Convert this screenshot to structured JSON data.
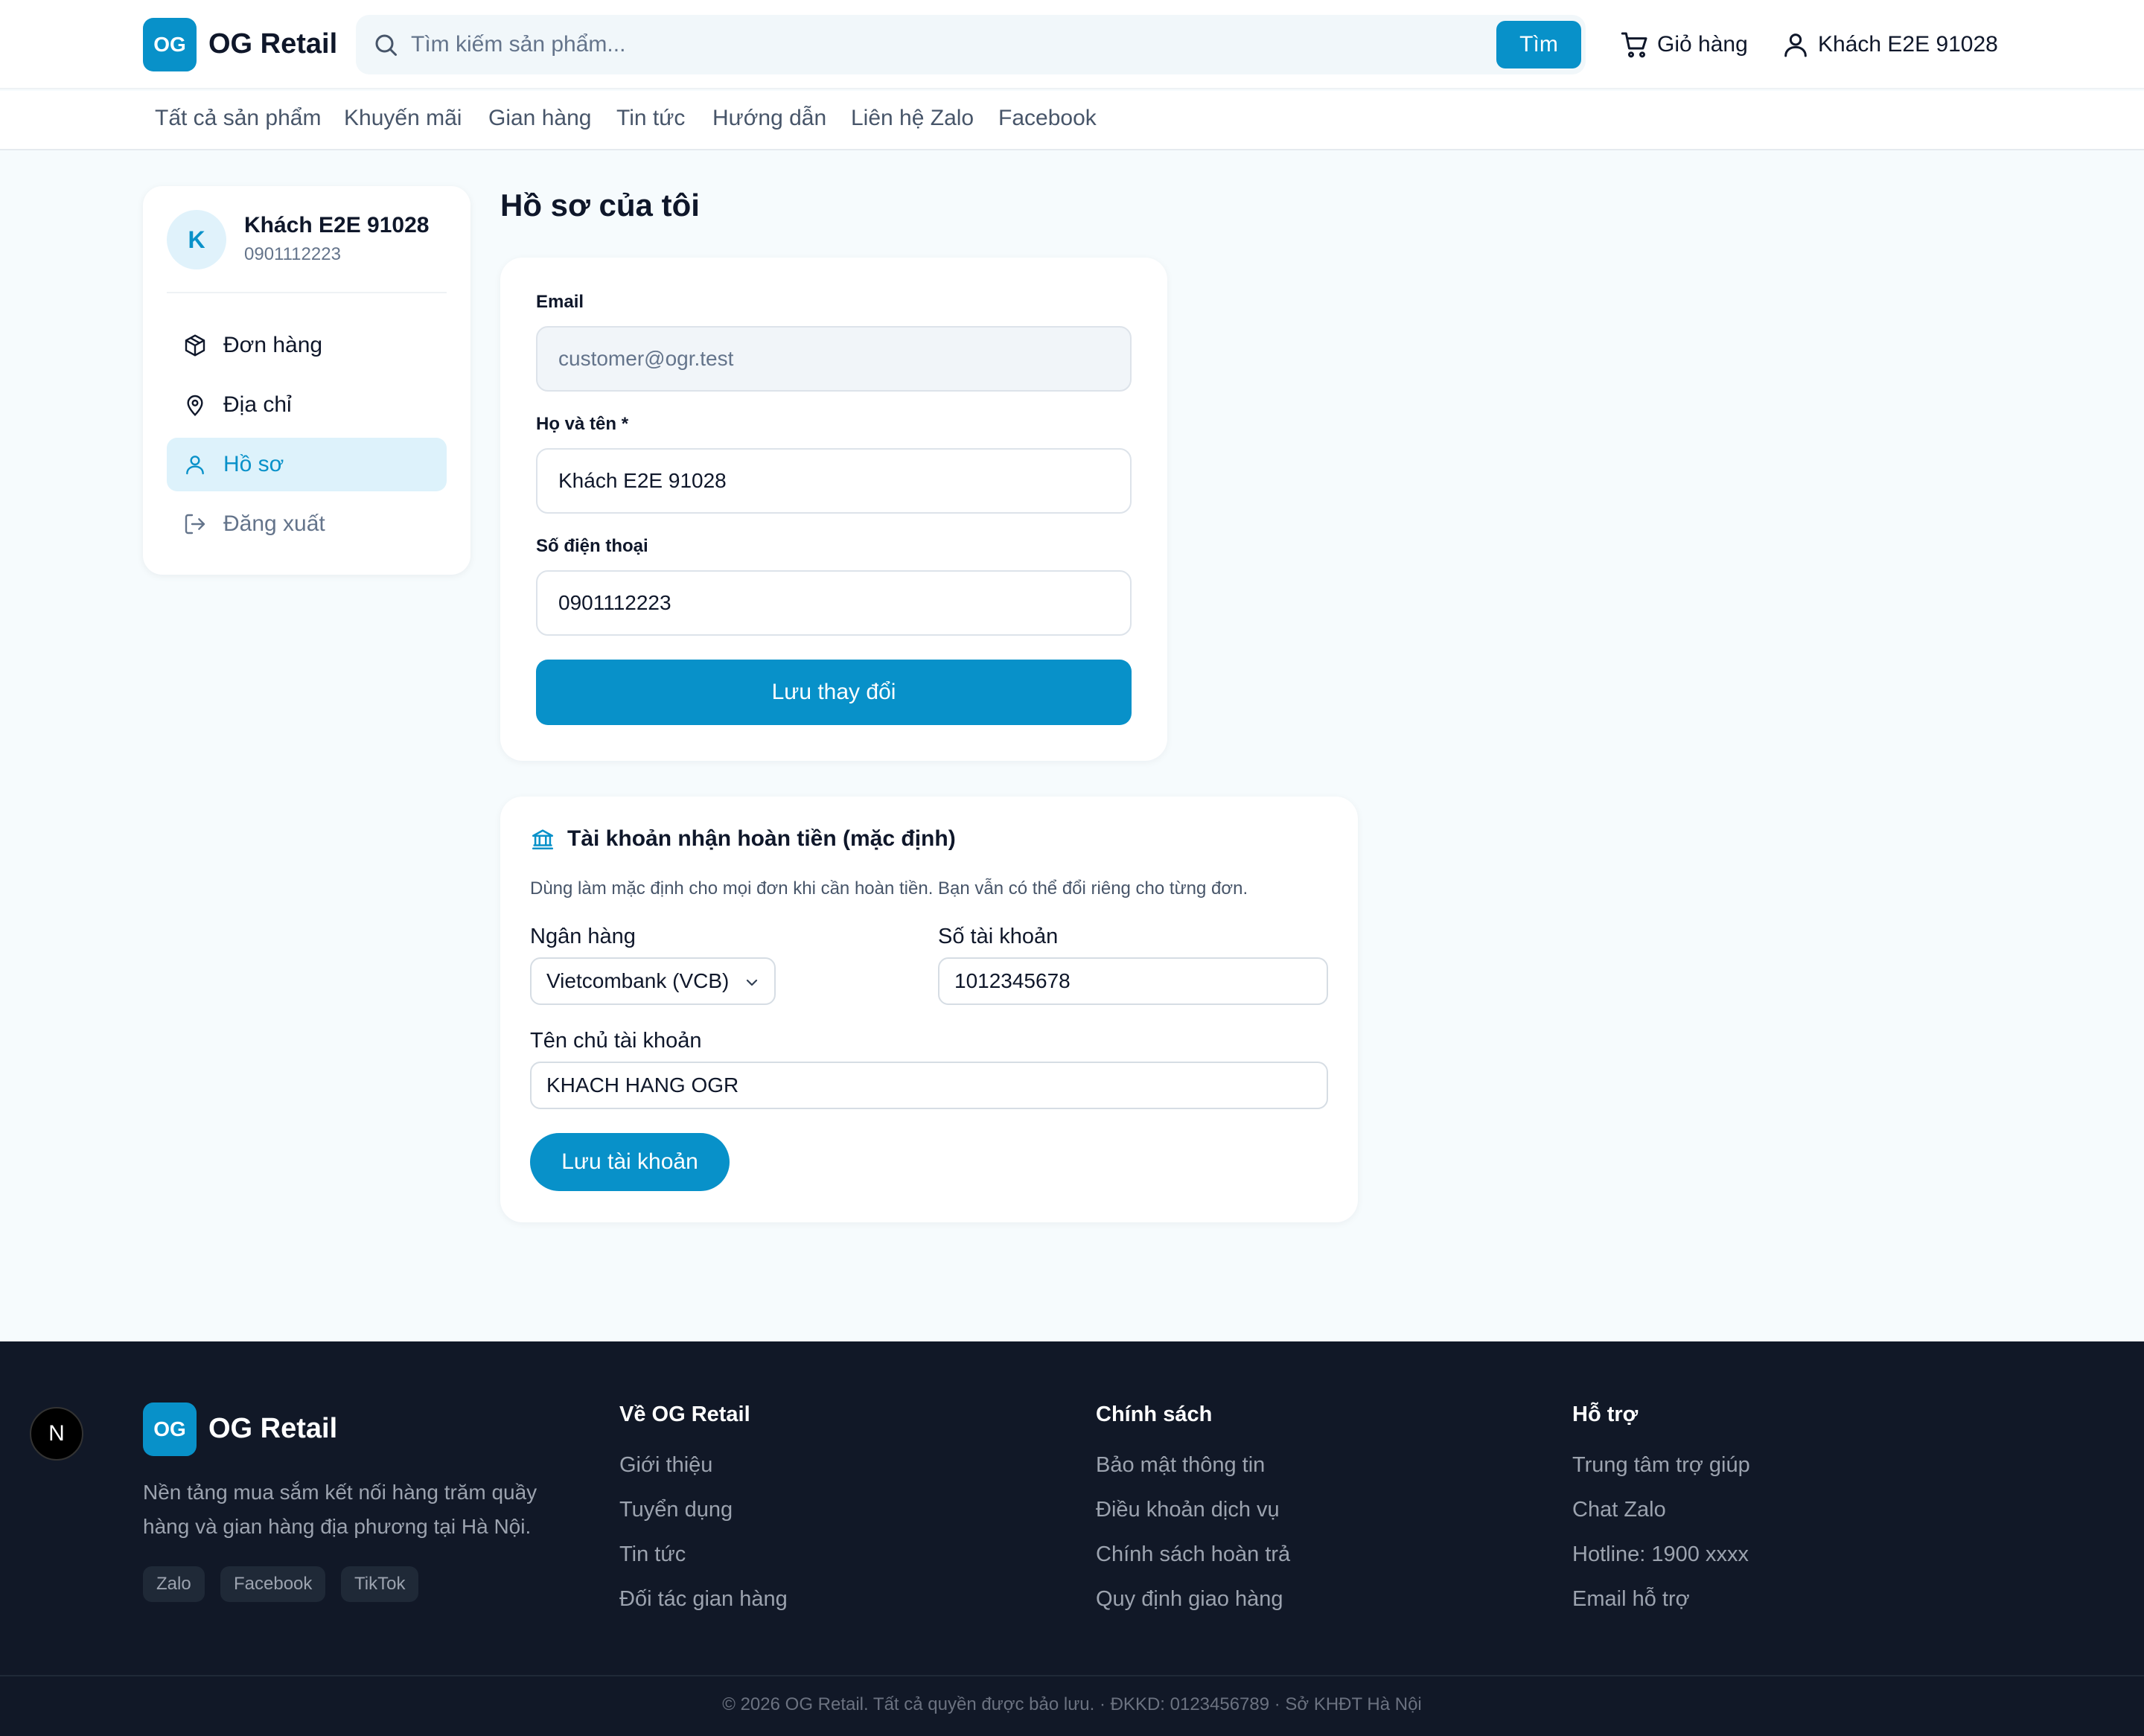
{
  "header": {
    "logo_badge": "OG",
    "logo_text": "OG Retail",
    "search_placeholder": "Tìm kiếm sản phẩm...",
    "search_button": "Tìm",
    "cart_label": "Giỏ hàng",
    "user_label": "Khách E2E 91028",
    "brand_color": "#0891c9"
  },
  "nav": {
    "items": [
      "Tất cả sản phẩm",
      "Khuyến mãi",
      "Gian hàng",
      "Tin tức",
      "Hướng dẫn",
      "Liên hệ Zalo",
      "Facebook"
    ]
  },
  "sidebar": {
    "avatar_letter": "K",
    "name": "Khách E2E 91028",
    "phone": "0901112223",
    "items": [
      {
        "label": "Đơn hàng",
        "icon": "package-icon"
      },
      {
        "label": "Địa chỉ",
        "icon": "map-pin-icon"
      },
      {
        "label": "Hồ sơ",
        "icon": "user-icon",
        "active": true
      },
      {
        "label": "Đăng xuất",
        "icon": "logout-icon"
      }
    ]
  },
  "profile": {
    "title": "Hồ sơ của tôi",
    "email_label": "Email",
    "email_value": "customer@ogr.test",
    "name_label": "Họ và tên *",
    "name_value": "Khách E2E 91028",
    "phone_label": "Số điện thoại",
    "phone_value": "0901112223",
    "save_button": "Lưu thay đổi"
  },
  "refund": {
    "title": "Tài khoản nhận hoàn tiền (mặc định)",
    "icon": "bank-icon",
    "description": "Dùng làm mặc định cho mọi đơn khi cần hoàn tiền. Bạn vẫn có thể đổi riêng cho từng đơn.",
    "bank_label": "Ngân hàng",
    "bank_value": "Vietcombank (VCB)",
    "account_number_label": "Số tài khoản",
    "account_number_value": "1012345678",
    "holder_label": "Tên chủ tài khoản",
    "holder_value": "KHACH HANG OGR",
    "save_button": "Lưu tài khoản"
  },
  "footer": {
    "next_badge": "N",
    "logo_badge": "OG",
    "logo_text": "OG Retail",
    "description": "Nền tảng mua sắm kết nối hàng trăm quầy hàng và gian hàng địa phương tại Hà Nội.",
    "socials": [
      "Zalo",
      "Facebook",
      "TikTok"
    ],
    "columns": [
      {
        "title": "Về OG Retail",
        "links": [
          "Giới thiệu",
          "Tuyển dụng",
          "Tin tức",
          "Đối tác gian hàng"
        ]
      },
      {
        "title": "Chính sách",
        "links": [
          "Bảo mật thông tin",
          "Điều khoản dịch vụ",
          "Chính sách hoàn trả",
          "Quy định giao hàng"
        ]
      },
      {
        "title": "Hỗ trợ",
        "links": [
          "Trung tâm trợ giúp",
          "Chat Zalo",
          "Hotline: 1900 xxxx",
          "Email hỗ trợ"
        ]
      }
    ],
    "copyright": "© 2026 OG Retail. Tất cả quyền được bảo lưu. · ĐKKD: 0123456789 · Sở KHĐT Hà Nội"
  }
}
